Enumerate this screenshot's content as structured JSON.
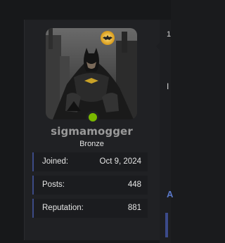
{
  "profile": {
    "username": "sigmamogger",
    "rank": "Bronze",
    "online": true,
    "avatar_icon": "batman-avatar-image",
    "stats": [
      {
        "label": "Joined:",
        "value": "Oct 9, 2024"
      },
      {
        "label": "Posts:",
        "value": "448"
      },
      {
        "label": "Reputation:",
        "value": "881"
      }
    ]
  },
  "right_panel": {
    "top_text": "1",
    "middle_text": "I",
    "accent_text": "A"
  },
  "colors": {
    "background": "#1a1b1d",
    "card": "#202124",
    "accent_bar": "#3c4a86",
    "online_dot": "#7ab800",
    "username": "#9a9a9a",
    "link": "#5a78c8"
  }
}
